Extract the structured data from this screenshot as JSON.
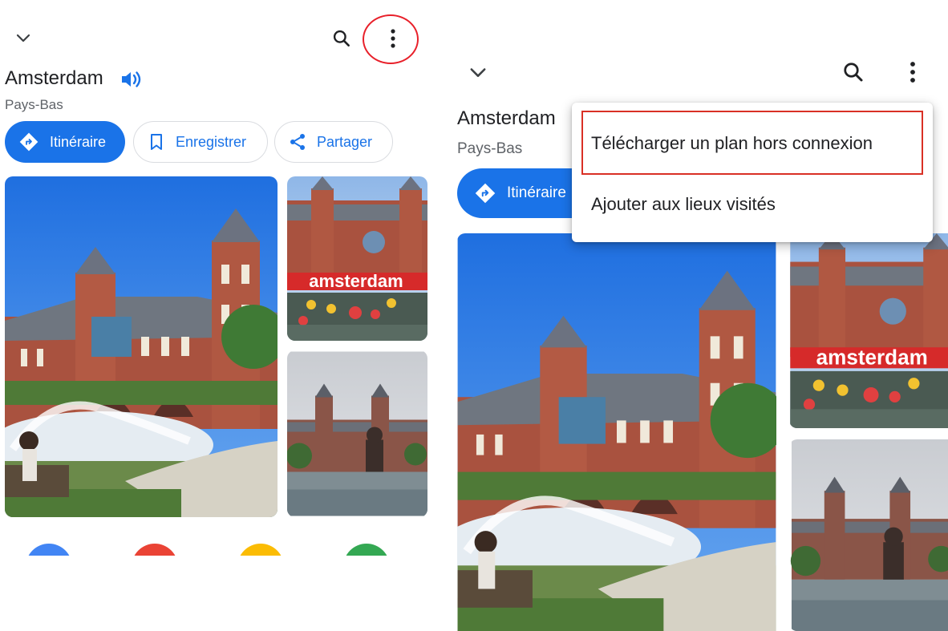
{
  "place": {
    "name": "Amsterdam",
    "country": "Pays-Bas",
    "audio_icon": "volume-icon"
  },
  "header": {
    "collapse_icon": "chevron-down-icon",
    "search_icon": "search-icon",
    "more_icon": "more-vert-icon"
  },
  "actions": [
    {
      "label": "Itinéraire",
      "icon": "directions-icon"
    },
    {
      "label": "Enregistrer",
      "icon": "bookmark-icon"
    },
    {
      "label": "Partager",
      "icon": "share-icon"
    }
  ],
  "overflow_menu": {
    "items": [
      {
        "label": "Télécharger un plan hors connexion"
      },
      {
        "label": "Ajouter aux lieux visités"
      }
    ]
  },
  "photos": {
    "overlay_text": "I amsterdam"
  },
  "quick_actions": {
    "colors": [
      "#4285f4",
      "#ea4335",
      "#fbbc04",
      "#34a853"
    ]
  },
  "colors": {
    "accent": "#1a73e8",
    "highlight_circle": "#e8202a",
    "highlight_box": "#d93025"
  }
}
